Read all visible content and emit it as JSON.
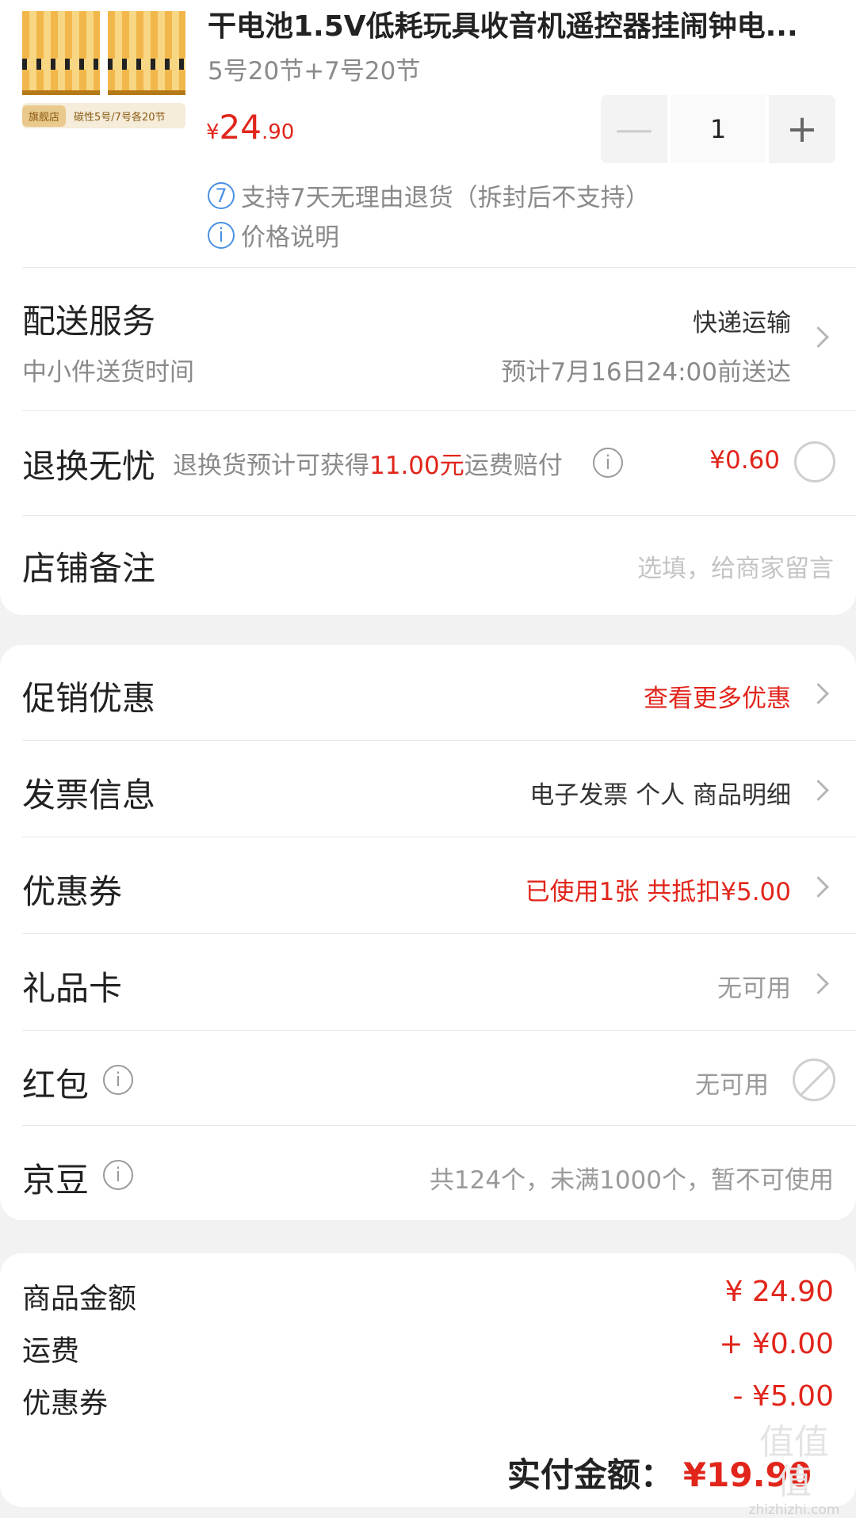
{
  "product": {
    "title": "干电池1.5V低耗玩具收音机遥控器挂闹钟电...",
    "spec": "5号20节+7号20节",
    "price_symbol": "¥",
    "price_int": "24",
    "price_dec": ".90",
    "quantity": "1",
    "minus": "—",
    "plus": "+",
    "thumb_tag_left": "旗舰店",
    "thumb_tag_right": "碳性5号/7号各20节",
    "return_badge": "7",
    "return_note": "支持7天无理由退货（拆封后不支持）",
    "price_note_icon": "i",
    "price_note": "价格说明"
  },
  "delivery": {
    "label": "配送服务",
    "method": "快递运输",
    "sub_label": "中小件送货时间",
    "eta": "预计7月16日24:00前送达"
  },
  "return_insurance": {
    "label": "退换无忧",
    "desc_pre": "退换货预计可获得",
    "desc_amount": "11.00元",
    "desc_post": "运费赔付",
    "price": "¥0.60"
  },
  "store_note": {
    "label": "店铺备注",
    "placeholder": "选填，给商家留言"
  },
  "promotions": {
    "label": "促销优惠",
    "value": "查看更多优惠"
  },
  "invoice": {
    "label": "发票信息",
    "value": "电子发票 个人 商品明细"
  },
  "coupon": {
    "label": "优惠券",
    "value": "已使用1张 共抵扣¥5.00"
  },
  "gift_card": {
    "label": "礼品卡",
    "value": "无可用"
  },
  "red_packet": {
    "label": "红包",
    "value": "无可用"
  },
  "jd_beans": {
    "label": "京豆",
    "value": "共124个，未满1000个，暂不可使用"
  },
  "summary": {
    "goods_label": "商品金额",
    "goods_value": "¥ 24.90",
    "shipping_label": "运费",
    "shipping_value": "+ ¥0.00",
    "coupon_label": "优惠券",
    "coupon_value": "- ¥5.00"
  },
  "payment": {
    "label": "实付金额：",
    "amount": "¥19.90"
  },
  "watermark": {
    "glyphs": "值值值",
    "domain": "zhizhizhi.com"
  },
  "colors": {
    "accent_red": "#e1251b",
    "info_blue": "#4a90e2"
  }
}
